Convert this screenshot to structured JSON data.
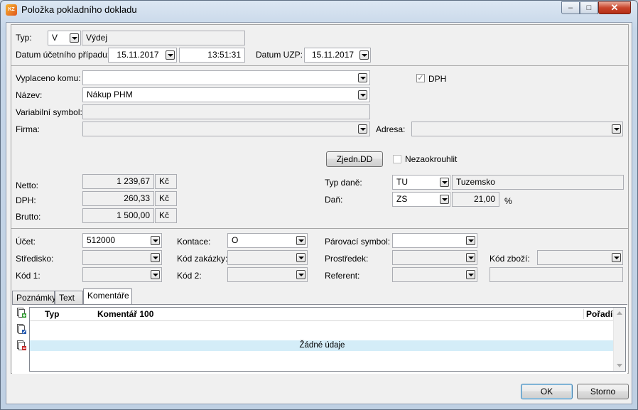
{
  "window": {
    "title": "Položka pokladního dokladu",
    "app_icon_text": "KZ"
  },
  "controls": {
    "minimize": "–",
    "maximize": "□",
    "close": "✕"
  },
  "header": {
    "typ_label": "Typ:",
    "typ_code": "V",
    "typ_name": "Výdej",
    "datum_label": "Datum účetního případu:",
    "datum_value": "15.11.2017",
    "time_value": "13:51:31",
    "datum_uzp_label": "Datum UZP:",
    "datum_uzp_value": "15.11.2017"
  },
  "party": {
    "vyplaceno_label": "Vyplaceno komu:",
    "vyplaceno_value": "",
    "nazev_label": "Název:",
    "nazev_value": "Nákup PHM",
    "varsym_label": "Variabilní symbol:",
    "varsym_value": "",
    "firma_label": "Firma:",
    "firma_value": "",
    "adresa_label": "Adresa:",
    "adresa_value": "",
    "dph_check_label": "DPH",
    "dph_checked": true,
    "zjedn_button": "Zjedn.DD",
    "nezaokrouhlit_label": "Nezaokrouhlit",
    "nezaokrouhlit_checked": false
  },
  "amounts": {
    "netto_label": "Netto:",
    "netto_value": "1 239,67",
    "dph_label": "DPH:",
    "dph_value": "260,33",
    "brutto_label": "Brutto:",
    "brutto_value": "1 500,00",
    "currency": "Kč",
    "typ_dane_label": "Typ daně:",
    "typ_dane_code": "TU",
    "typ_dane_name": "Tuzemsko",
    "dan_label": "Daň:",
    "dan_code": "ZS",
    "dan_rate": "21,00",
    "percent": "%"
  },
  "accounting": {
    "ucet_label": "Účet:",
    "ucet_value": "512000",
    "kontace_label": "Kontace:",
    "kontace_value": "O",
    "parovaci_label": "Párovací symbol:",
    "parovaci_value": "",
    "stredisko_label": "Středisko:",
    "stredisko_value": "",
    "kod_zakazky_label": "Kód zakázky:",
    "kod_zakazky_value": "",
    "prostredek_label": "Prostředek:",
    "prostredek_value": "",
    "kod_zbozi_label": "Kód zboží:",
    "kod_zbozi_value": "",
    "kod1_label": "Kód 1:",
    "kod1_value": "",
    "kod2_label": "Kód 2:",
    "kod2_value": "",
    "referent_label": "Referent:",
    "referent_value": ""
  },
  "tabs": [
    {
      "label": "Poznámky",
      "active": false
    },
    {
      "label": "Text",
      "active": false
    },
    {
      "label": "Komentáře",
      "active": true
    }
  ],
  "grid": {
    "columns": [
      "Typ",
      "Komentář 100",
      "Pořadí"
    ],
    "empty_text": "Žádné údaje",
    "side_icons": [
      "add-record-icon",
      "edit-record-icon",
      "delete-record-icon"
    ]
  },
  "footer": {
    "ok": "OK",
    "cancel": "Storno"
  }
}
